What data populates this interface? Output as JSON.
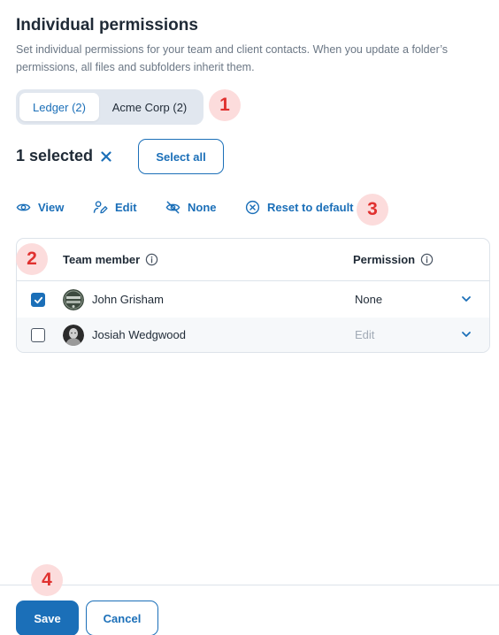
{
  "header": {
    "title": "Individual permissions",
    "description": "Set individual permissions for your team and client contacts. When you update a folder’s permissions, all files and subfolders inherit them."
  },
  "tabs": [
    {
      "label": "Ledger (2)",
      "active": true
    },
    {
      "label": "Acme Corp (2)",
      "active": false
    }
  ],
  "markers": [
    "1",
    "2",
    "3",
    "4"
  ],
  "selection": {
    "count_label": "1 selected",
    "clear_icon": "close-icon",
    "select_all_label": "Select all"
  },
  "actions": [
    {
      "label": "View",
      "icon": "eye-icon"
    },
    {
      "label": "Edit",
      "icon": "pen-user-icon"
    },
    {
      "label": "None",
      "icon": "eye-slash-icon"
    },
    {
      "label": "Reset to default",
      "icon": "circle-x-icon"
    }
  ],
  "table": {
    "headers": {
      "member": "Team member",
      "permission": "Permission"
    },
    "rows": [
      {
        "name": "John Grisham",
        "permission": "None",
        "checked": true,
        "permission_muted": false
      },
      {
        "name": "Josiah Wedgwood",
        "permission": "Edit",
        "checked": false,
        "permission_muted": true
      }
    ]
  },
  "footer": {
    "save_label": "Save",
    "cancel_label": "Cancel"
  },
  "colors": {
    "accent": "#1b6fb8",
    "marker_bg": "#fcdcdc",
    "marker_fg": "#e0312f"
  }
}
